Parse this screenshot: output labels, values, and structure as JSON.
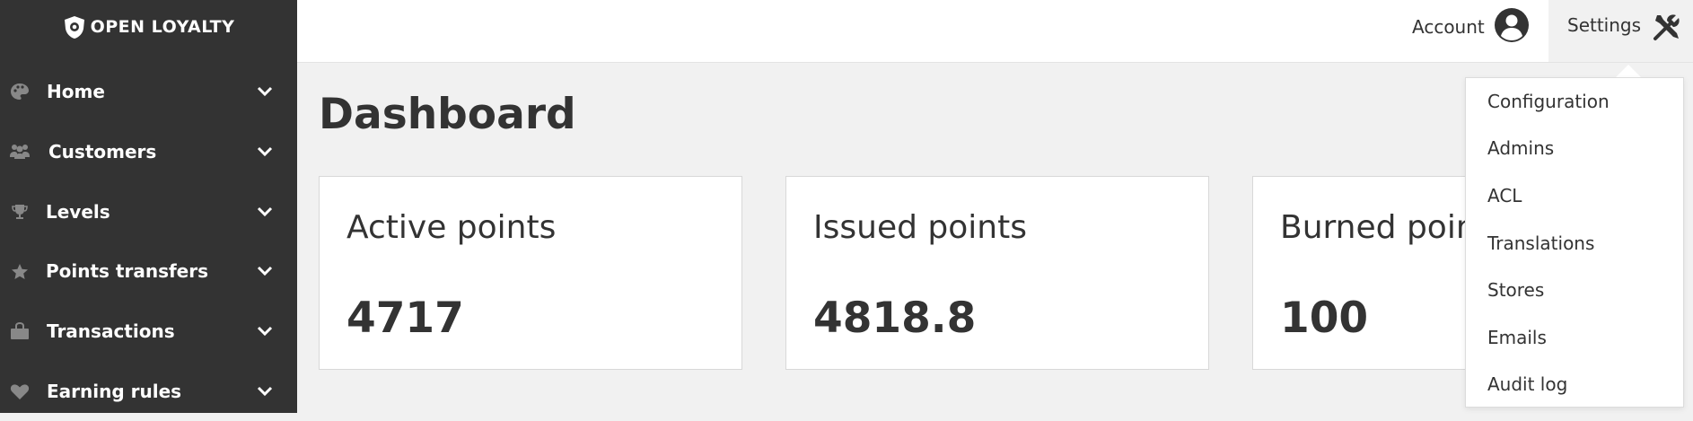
{
  "brand": {
    "logo_text": "OPEN LOYALTY"
  },
  "sidebar": {
    "items": [
      {
        "label": "Home",
        "icon": "palette-icon"
      },
      {
        "label": "Customers",
        "icon": "users-icon"
      },
      {
        "label": "Levels",
        "icon": "trophy-icon"
      },
      {
        "label": "Points transfers",
        "icon": "star-icon"
      },
      {
        "label": "Transactions",
        "icon": "shopping-bag-icon"
      },
      {
        "label": "Earning rules",
        "icon": "heart-icon"
      }
    ]
  },
  "header": {
    "account_label": "Account",
    "settings_label": "Settings"
  },
  "main": {
    "title": "Dashboard",
    "cards": [
      {
        "title": "Active points",
        "value": "4717"
      },
      {
        "title": "Issued points",
        "value": "4818.8"
      },
      {
        "title": "Burned points",
        "value": "100"
      }
    ]
  },
  "settings_menu": {
    "items": [
      "Configuration",
      "Admins",
      "ACL",
      "Translations",
      "Stores",
      "Emails",
      "Audit log"
    ]
  },
  "colors": {
    "sidebar_bg": "#333333",
    "page_bg": "#f1f1f1",
    "text": "#333333"
  }
}
